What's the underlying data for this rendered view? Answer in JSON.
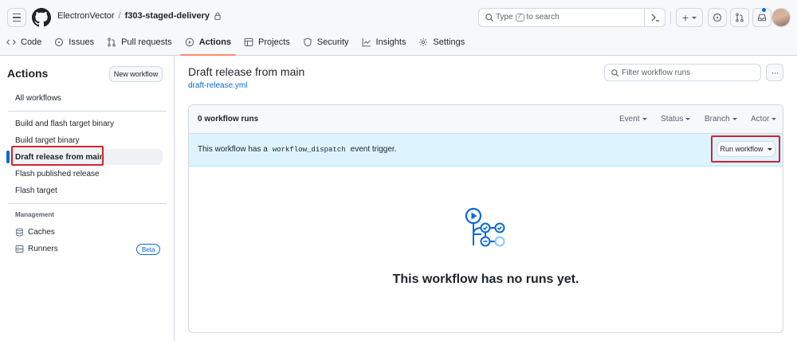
{
  "header": {
    "owner": "ElectronVector",
    "separator": "/",
    "repo": "f303-staged-delivery",
    "search_prefix": "Type",
    "search_key": "/",
    "search_suffix": "to search",
    "plus_label": "+",
    "notification_dot_color": "#0969da"
  },
  "nav": {
    "tabs": [
      {
        "label": "Code",
        "icon": "code-icon"
      },
      {
        "label": "Issues",
        "icon": "issue-icon"
      },
      {
        "label": "Pull requests",
        "icon": "pull-request-icon"
      },
      {
        "label": "Actions",
        "icon": "play-icon",
        "active": true
      },
      {
        "label": "Projects",
        "icon": "table-icon"
      },
      {
        "label": "Security",
        "icon": "shield-icon"
      },
      {
        "label": "Insights",
        "icon": "graph-icon"
      },
      {
        "label": "Settings",
        "icon": "gear-icon"
      }
    ]
  },
  "sidebar": {
    "title": "Actions",
    "new_workflow": "New workflow",
    "all_workflows": "All workflows",
    "workflows": [
      "Build and flash target binary",
      "Build target binary",
      "Draft release from main",
      "Flash published release",
      "Flash target"
    ],
    "selected_index": 2,
    "management_heading": "Management",
    "caches": "Caches",
    "runners": "Runners",
    "runners_badge": "Beta"
  },
  "main": {
    "title": "Draft release from main",
    "file": "draft-release.yml",
    "filter_placeholder": "Filter workflow runs",
    "more_label": "···",
    "runs_count": "0 workflow runs",
    "filters": [
      "Event",
      "Status",
      "Branch",
      "Actor"
    ],
    "trigger_prefix": "This workflow has a",
    "trigger_code": "workflow_dispatch",
    "trigger_suffix": "event trigger.",
    "run_workflow": "Run workflow",
    "empty_message": "This workflow has no runs yet."
  },
  "colors": {
    "accent": "#0969da",
    "active_tab_underline": "#fd8c73",
    "highlight_box": "#d1242f",
    "trigger_bg": "#ddf4ff"
  }
}
